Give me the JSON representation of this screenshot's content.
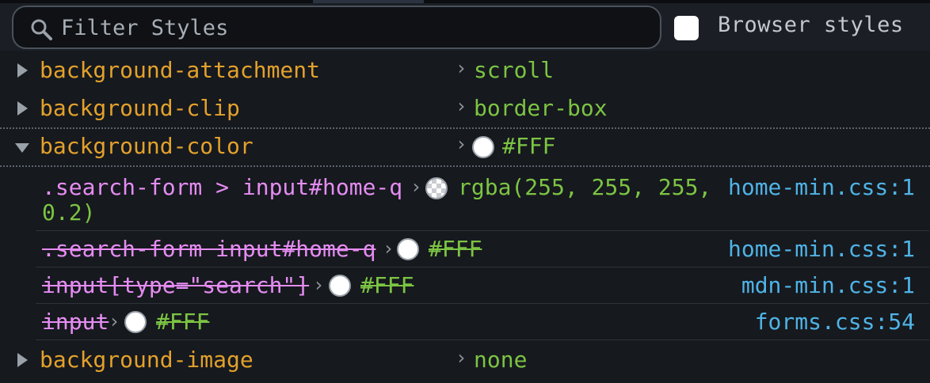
{
  "filter": {
    "placeholder": "Filter Styles",
    "browser_styles_label": "Browser styles",
    "browser_styles_checked": false
  },
  "properties": [
    {
      "name": "background-attachment",
      "value": "scroll",
      "expanded": false
    },
    {
      "name": "background-clip",
      "value": "border-box",
      "expanded": false
    },
    {
      "name": "background-color",
      "value": "#FFF",
      "expanded": true,
      "swatch": "#FFFFFF"
    },
    {
      "name": "background-image",
      "value": "none",
      "expanded": false
    }
  ],
  "matched_rules": [
    {
      "selector": ".search-form > input#home-q",
      "value_line1": "rgba(255, 255, 255,",
      "value_line2": "0.2)",
      "source": "home-min.css:1",
      "overridden": false
    },
    {
      "selector": ".search-form input#home-q",
      "value": "#FFF",
      "source": "home-min.css:1",
      "overridden": true
    },
    {
      "selector": "input[type=\"search\"]",
      "value": "#FFF",
      "source": "mdn-min.css:1",
      "overridden": true
    },
    {
      "selector": "input",
      "value": "#FFF",
      "source": "forms.css:54",
      "overridden": true
    }
  ],
  "icons": {
    "search": "search-icon",
    "twisty": "chevron-right-icon",
    "arrow": "chevron-right-icon"
  },
  "colors": {
    "property_name": "#e3a12c",
    "value": "#7cc443",
    "selector": "#e58cf2",
    "source_link": "#4fb3e6",
    "background": "#16191e"
  }
}
